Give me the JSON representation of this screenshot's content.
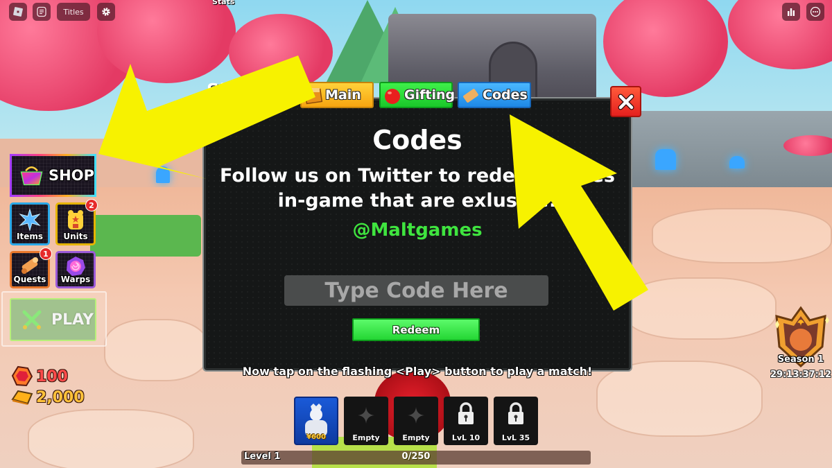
{
  "topbar": {
    "titles_label": "Titles",
    "stats_label": "Stats",
    "left_icons": [
      "roblox-logo-icon",
      "chat-icon",
      "gear-icon"
    ],
    "right_icons": [
      "leaderboard-icon",
      "more-icon"
    ]
  },
  "side_menu": {
    "shop": {
      "label": "SHOP",
      "icon": "shop-basket-icon"
    },
    "items": {
      "label": "Items",
      "icon": "star-crystal-icon"
    },
    "units": {
      "label": "Units",
      "icon": "backpack-icon",
      "badge": "2"
    },
    "quests": {
      "label": "Quests",
      "icon": "scroll-icon",
      "badge": "1"
    },
    "warps": {
      "label": "Warps",
      "icon": "portal-icon"
    },
    "play": {
      "label": "PLAY",
      "icon": "crossed-swords-icon"
    }
  },
  "currency": {
    "gems": "100",
    "gold": "2,000"
  },
  "panel": {
    "header_partial": "Sh",
    "tabs": [
      {
        "label": "Main",
        "icon": "crate-icon",
        "color": "#f7a510"
      },
      {
        "label": "Gifting",
        "icon": "apple-icon",
        "color": "#1ac82a"
      },
      {
        "label": "Codes",
        "icon": "ticket-icon",
        "color": "#1e88e5"
      }
    ],
    "active_tab": "Codes",
    "title": "Codes",
    "description_line1": "Follow us on Twitter to redeem codes",
    "description_line2": "in-game that are exlusive!",
    "handle": "@Maltgames",
    "input_placeholder": "Type Code Here",
    "input_value": "",
    "redeem_label": "Redeem",
    "close_icon": "close-icon"
  },
  "tutorial_text": "Now tap on the flashing <Play> button to play a match!",
  "hotbar": {
    "slots": [
      {
        "type": "unit",
        "cost": "¥600"
      },
      {
        "type": "empty",
        "label": "Empty"
      },
      {
        "type": "empty",
        "label": "Empty"
      },
      {
        "type": "locked",
        "label": "LvL 10"
      },
      {
        "type": "locked",
        "label": "LvL 35"
      }
    ]
  },
  "level": {
    "label": "Level 1",
    "xp_text": "0/250",
    "xp_current": 0,
    "xp_max": 250
  },
  "season": {
    "label": "Season 1",
    "timer": "29:13:37:12"
  },
  "colors": {
    "accent_yellow_arrow": "#f7f200",
    "handle_green": "#3fe43f",
    "redeem_green": "#24d634",
    "close_red": "#e4201e"
  }
}
